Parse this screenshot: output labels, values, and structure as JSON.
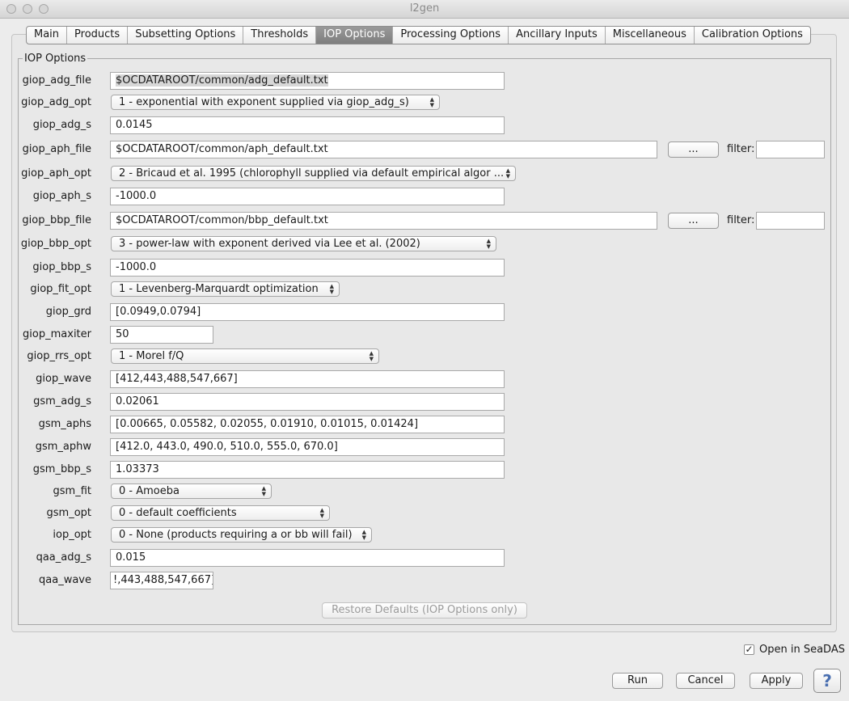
{
  "window": {
    "title": "l2gen"
  },
  "tabs": [
    {
      "label": "Main",
      "active": false
    },
    {
      "label": "Products",
      "active": false
    },
    {
      "label": "Subsetting Options",
      "active": false
    },
    {
      "label": "Thresholds",
      "active": false
    },
    {
      "label": "IOP Options",
      "active": true
    },
    {
      "label": "Processing Options",
      "active": false
    },
    {
      "label": "Ancillary Inputs",
      "active": false
    },
    {
      "label": "Miscellaneous",
      "active": false
    },
    {
      "label": "Calibration Options",
      "active": false
    }
  ],
  "group": {
    "title": "IOP Options",
    "params": {
      "giop_adg_file": {
        "label": "giop_adg_file",
        "value": "$OCDATAROOT/common/adg_default.txt"
      },
      "giop_adg_opt": {
        "label": "giop_adg_opt",
        "value": "1 - exponential with exponent supplied via giop_adg_s)"
      },
      "giop_adg_s": {
        "label": "giop_adg_s",
        "value": "0.0145"
      },
      "giop_aph_file": {
        "label": "giop_aph_file",
        "value": "$OCDATAROOT/common/aph_default.txt"
      },
      "giop_aph_opt": {
        "label": "giop_aph_opt",
        "value": "2 - Bricaud et al. 1995 (chlorophyll supplied via default empirical algor ..."
      },
      "giop_aph_s": {
        "label": "giop_aph_s",
        "value": "-1000.0"
      },
      "giop_bbp_file": {
        "label": "giop_bbp_file",
        "value": "$OCDATAROOT/common/bbp_default.txt"
      },
      "giop_bbp_opt": {
        "label": "giop_bbp_opt",
        "value": "3 - power-law with exponent derived via Lee et al. (2002)"
      },
      "giop_bbp_s": {
        "label": "giop_bbp_s",
        "value": "-1000.0"
      },
      "giop_fit_opt": {
        "label": "giop_fit_opt",
        "value": "1 - Levenberg-Marquardt optimization"
      },
      "giop_grd": {
        "label": "giop_grd",
        "value": "[0.0949,0.0794]"
      },
      "giop_maxiter": {
        "label": "giop_maxiter",
        "value": "50"
      },
      "giop_rrs_opt": {
        "label": "giop_rrs_opt",
        "value": "1 - Morel f/Q"
      },
      "giop_wave": {
        "label": "giop_wave",
        "value": "[412,443,488,547,667]"
      },
      "gsm_adg_s": {
        "label": "gsm_adg_s",
        "value": "0.02061"
      },
      "gsm_aphs": {
        "label": "gsm_aphs",
        "value": "[0.00665, 0.05582, 0.02055, 0.01910, 0.01015, 0.01424]"
      },
      "gsm_aphw": {
        "label": "gsm_aphw",
        "value": "[412.0, 443.0, 490.0, 510.0, 555.0, 670.0]"
      },
      "gsm_bbp_s": {
        "label": "gsm_bbp_s",
        "value": "1.03373"
      },
      "gsm_fit": {
        "label": "gsm_fit",
        "value": "0 - Amoeba"
      },
      "gsm_opt": {
        "label": "gsm_opt",
        "value": "0 - default coefficients"
      },
      "iop_opt": {
        "label": "iop_opt",
        "value": "0 - None (products requiring a or bb will fail)"
      },
      "qaa_adg_s": {
        "label": "qaa_adg_s",
        "value": "0.015"
      },
      "qaa_wave": {
        "label": "qaa_wave",
        "value": "!,443,488,547,667]"
      }
    },
    "browse_label": "...",
    "filter_label": "filter:",
    "filter_value": "",
    "restore_label": "Restore Defaults (IOP Options only)"
  },
  "footer": {
    "open_in_seadas_label": "Open in SeaDAS",
    "open_in_seadas_checked": true,
    "run_label": "Run",
    "cancel_label": "Cancel",
    "apply_label": "Apply",
    "help_label": "?"
  }
}
